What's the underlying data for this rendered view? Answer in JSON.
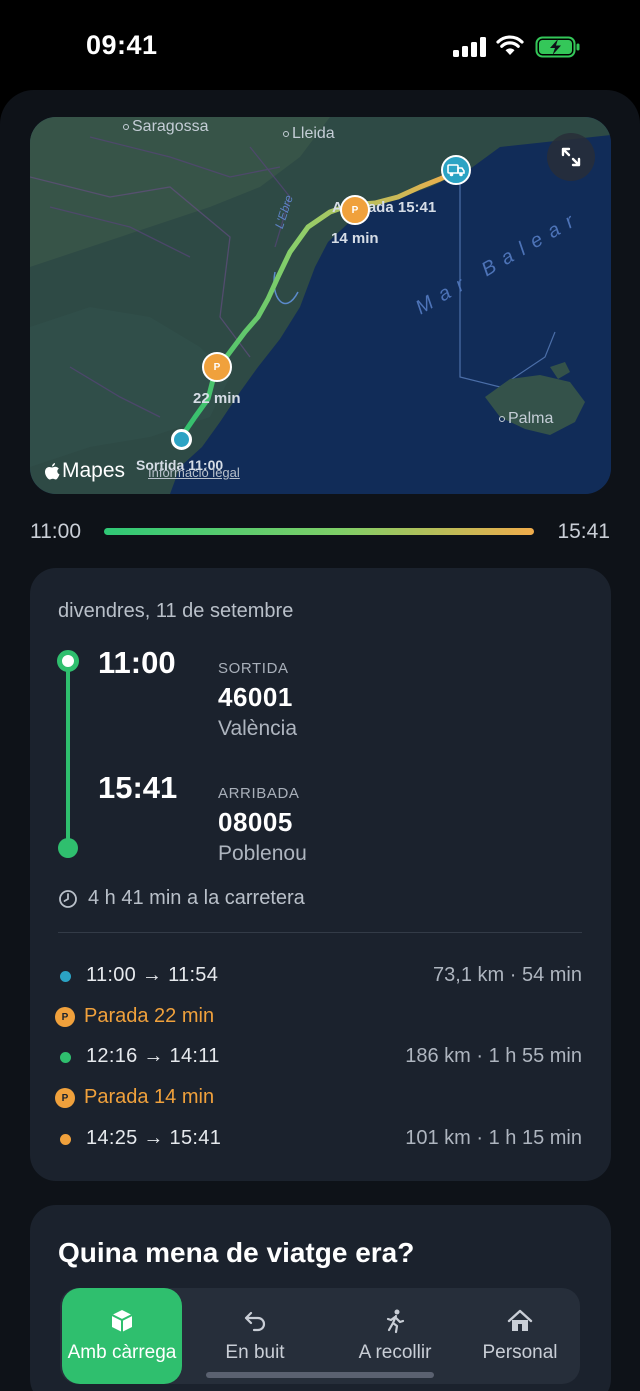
{
  "status_bar": {
    "time": "09:41"
  },
  "map": {
    "cities": {
      "saragossa": "Saragossa",
      "lleida": "Lleida",
      "palma": "Palma"
    },
    "sea_label": "Mar Balear",
    "river_label": "L'Ebre",
    "pins": {
      "departure": "Sortida 11:00",
      "arrival": "Arribada 15:41",
      "stop1": "22 min",
      "stop2": "14 min",
      "stop_glyph": "P"
    },
    "attribution": "Mapes",
    "legal_link": "Informació legal",
    "expand_icon": "expand-arrows-icon"
  },
  "progress": {
    "start": "11:00",
    "end": "15:41",
    "completed": 1.0
  },
  "trip": {
    "date": "divendres, 11 de setembre",
    "departure": {
      "time": "11:00",
      "caption": "SORTIDA",
      "code": "46001",
      "city": "València"
    },
    "arrival": {
      "time": "15:41",
      "caption": "ARRIBADA",
      "code": "08005",
      "city": "Poblenou"
    },
    "duration": "4 h 41 min a la carretera",
    "segments": [
      {
        "kind": "drive",
        "times": "11:00 → 11:54",
        "info": "73,1 km · 54 min",
        "color": "#2ba3c4"
      },
      {
        "kind": "stop",
        "label": "Parada 22 min",
        "glyph": "P"
      },
      {
        "kind": "drive",
        "times": "12:16 → 14:11",
        "info": "186 km · 1 h 55 min",
        "color": "#2fbf6e"
      },
      {
        "kind": "stop",
        "label": "Parada 14 min",
        "glyph": "P"
      },
      {
        "kind": "drive",
        "times": "14:25 → 15:41",
        "info": "101 km · 1 h 15 min",
        "color": "#f0a13c"
      }
    ]
  },
  "trip_type": {
    "title": "Quina mena de viatge era?",
    "options": [
      {
        "label": "Amb càrrega",
        "icon": "box-icon",
        "selected": true
      },
      {
        "label": "En buit",
        "icon": "return-arrow-icon",
        "selected": false
      },
      {
        "label": "A recollir",
        "icon": "walking-person-icon",
        "selected": false
      },
      {
        "label": "Personal",
        "icon": "home-icon",
        "selected": false
      }
    ]
  },
  "colors": {
    "accent_green": "#2fbf6e",
    "stop_orange": "#f0a13c",
    "card_bg": "#1b222d"
  }
}
